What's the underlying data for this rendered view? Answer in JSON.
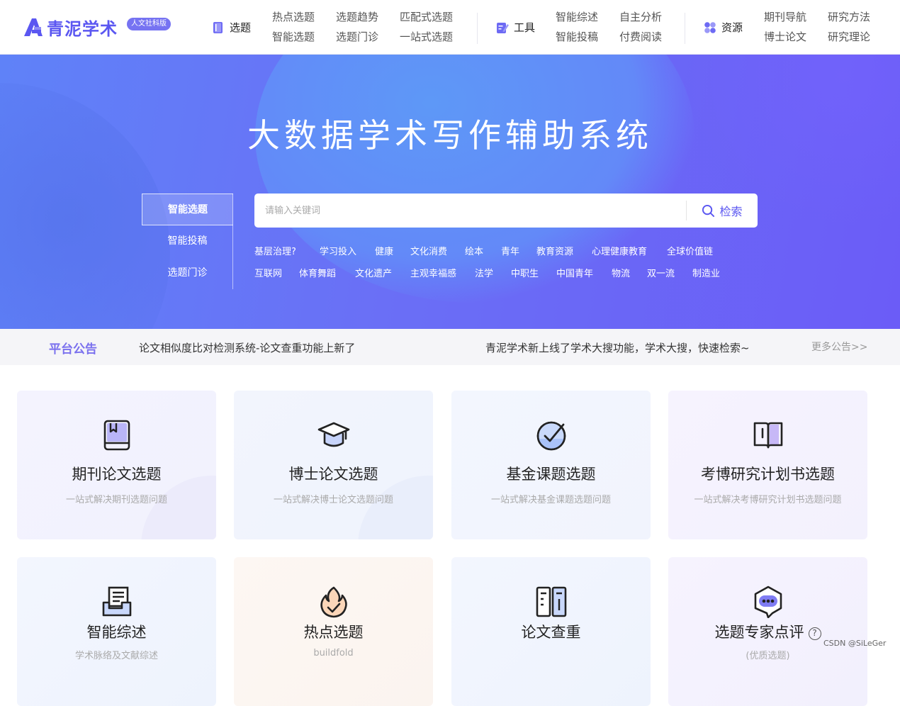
{
  "header": {
    "logo_text": "青泥学术",
    "logo_badge": "人文社科版",
    "nav": [
      {
        "label": "选题",
        "icon": "book-icon",
        "links": [
          "热点选题",
          "选题趋势",
          "匹配式选题",
          "智能选题",
          "选题门诊",
          "一站式选题"
        ]
      },
      {
        "label": "工具",
        "icon": "edit-icon",
        "links": [
          "智能综述",
          "自主分析",
          "智能投稿",
          "付费阅读"
        ]
      },
      {
        "label": "资源",
        "icon": "grid-icon",
        "links": [
          "期刊导航",
          "研究方法",
          "博士论文",
          "研究理论"
        ]
      }
    ]
  },
  "hero": {
    "title": "大数据学术写作辅助系统",
    "modes": [
      "智能选题",
      "智能投稿",
      "选题门诊"
    ],
    "active_mode": "智能选题",
    "search": {
      "placeholder": "请输入关键词",
      "button": "检索"
    },
    "keywords": [
      [
        "基层治理?",
        "学习投入",
        "健康",
        "文化消费",
        "绘本",
        "青年",
        "教育资源",
        "心理健康教育",
        "全球价值链"
      ],
      [
        "互联网",
        "体育舞蹈",
        "文化遗产",
        "主观幸福感",
        "法学",
        "中职生",
        "中国青年",
        "物流",
        "双一流",
        "制造业"
      ]
    ]
  },
  "notice": {
    "title": "平台公告",
    "items": [
      "论文相似度比对检测系统-论文查重功能上新了",
      "青泥学术新上线了学术大搜功能，学术大搜，快速检索~"
    ],
    "more": "更多公告>>"
  },
  "cards": [
    {
      "title": "期刊论文选题",
      "desc": "一站式解决期刊选题问题",
      "icon": "journal-book-icon"
    },
    {
      "title": "博士论文选题",
      "desc": "一站式解决博士论文选题问题",
      "icon": "graduation-cap-icon"
    },
    {
      "title": "基金课题选题",
      "desc": "一站式解决基金课题选题问题",
      "icon": "check-circle-icon"
    },
    {
      "title": "考博研究计划书选题",
      "desc": "一站式解决考博研究计划书选题问题",
      "icon": "open-book-icon"
    },
    {
      "title": "智能综述",
      "desc": "学术脉络及文献综述",
      "icon": "document-tray-icon"
    },
    {
      "title": "热点选题",
      "desc": "buildfold",
      "icon": "flame-icon"
    },
    {
      "title": "论文查重",
      "desc": "",
      "icon": "split-document-icon"
    },
    {
      "title": "选题专家点评",
      "desc": "(优质选题)",
      "icon": "chat-bubble-icon"
    }
  ],
  "watermark": "CSDN @SiLeGer",
  "colors": {
    "brand": "#5b57f1",
    "hero_start": "#5f82f8",
    "hero_end": "#6b5cf7",
    "notice_title": "#7a70ee"
  }
}
